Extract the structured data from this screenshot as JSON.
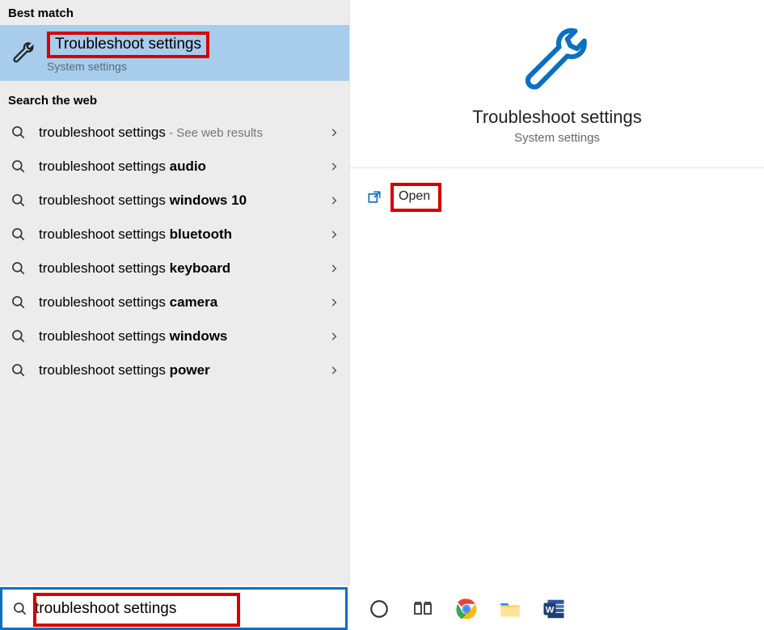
{
  "left": {
    "best_match_header": "Best match",
    "best_match": {
      "title": "Troubleshoot settings",
      "subtitle": "System settings"
    },
    "web_header": "Search the web",
    "web_items": [
      {
        "prefix": "troubleshoot settings",
        "bold": "",
        "note": " - See web results"
      },
      {
        "prefix": "troubleshoot settings ",
        "bold": "audio",
        "note": ""
      },
      {
        "prefix": "troubleshoot settings ",
        "bold": "windows 10",
        "note": ""
      },
      {
        "prefix": "troubleshoot settings ",
        "bold": "bluetooth",
        "note": ""
      },
      {
        "prefix": "troubleshoot settings ",
        "bold": "keyboard",
        "note": ""
      },
      {
        "prefix": "troubleshoot settings ",
        "bold": "camera",
        "note": ""
      },
      {
        "prefix": "troubleshoot settings ",
        "bold": "windows",
        "note": ""
      },
      {
        "prefix": "troubleshoot settings ",
        "bold": "power",
        "note": ""
      }
    ]
  },
  "right": {
    "title": "Troubleshoot settings",
    "subtitle": "System settings",
    "open_label": "Open"
  },
  "search": {
    "value": "troubleshoot settings"
  }
}
